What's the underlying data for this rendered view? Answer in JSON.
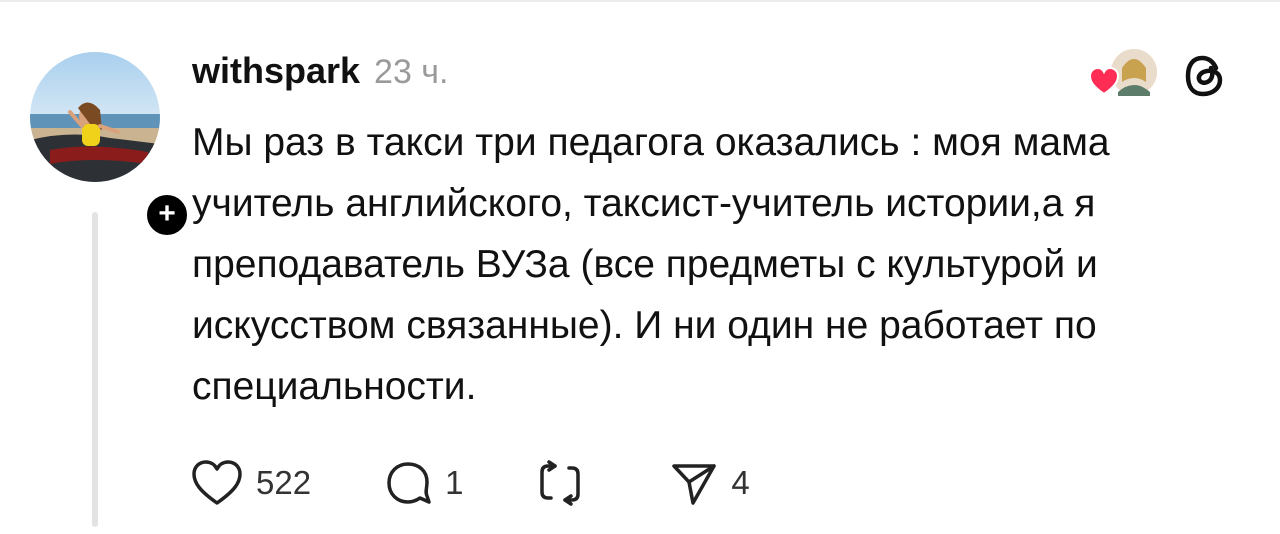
{
  "post": {
    "username": "withspark",
    "time": "23 ч.",
    "text": "Мы раз в такси три педагога оказались : моя мама учитель английского, таксист-учитель истории,а я преподаватель ВУЗа (все предметы с культурой и искусством связанные). И ни один не работает по специальности.",
    "avatar_icon": "avatar-photo",
    "follow_icon": "plus-icon",
    "app_icon": "threads-logo-icon"
  },
  "actions": {
    "like_count": "522",
    "reply_count": "1",
    "repost_count": "",
    "share_count": "4"
  },
  "colors": {
    "text": "#111111",
    "muted": "#9a9a9a",
    "heart": "#ff2d55",
    "thread_line": "#e3e3e3"
  }
}
